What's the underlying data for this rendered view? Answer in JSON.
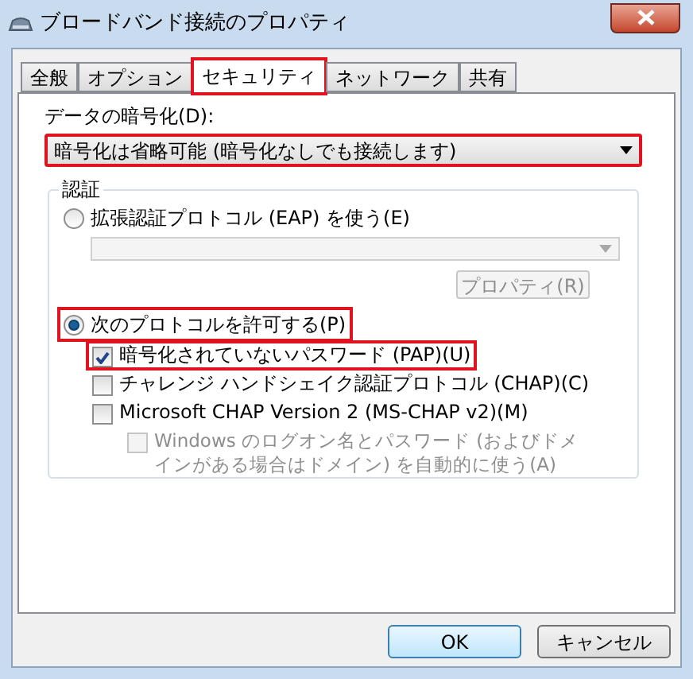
{
  "window": {
    "title": "ブロードバンド接続のプロパティ"
  },
  "tabs": [
    {
      "label": "全般",
      "selected": false,
      "highlighted": false
    },
    {
      "label": "オプション",
      "selected": false,
      "highlighted": false
    },
    {
      "label": "セキュリティ",
      "selected": true,
      "highlighted": true
    },
    {
      "label": "ネットワーク",
      "selected": false,
      "highlighted": false
    },
    {
      "label": "共有",
      "selected": false,
      "highlighted": false
    }
  ],
  "encryption": {
    "label": "データの暗号化(D):",
    "value": "暗号化は省略可能 (暗号化なしでも接続します)",
    "highlighted": true
  },
  "authentication": {
    "title": "認証",
    "eap": {
      "label": "拡張認証プロトコル (EAP) を使う(E)",
      "selected": false,
      "highlighted": false
    },
    "eap_properties_button": {
      "label": "プロパティ(R)",
      "disabled": true
    },
    "allow_protocols": {
      "label": "次のプロトコルを許可する(P)",
      "selected": true,
      "highlighted": true
    },
    "protocols": [
      {
        "label": "暗号化されていないパスワード (PAP)(U)",
        "checked": true,
        "disabled": false,
        "highlighted": true
      },
      {
        "label": "チャレンジ ハンドシェイク認証プロトコル (CHAP)(C)",
        "checked": false,
        "disabled": false,
        "highlighted": false
      },
      {
        "label": "Microsoft CHAP Version 2 (MS-CHAP v2)(M)",
        "checked": false,
        "disabled": false,
        "highlighted": false,
        "children": [
          {
            "label": "Windows のログオン名とパスワード (およびドメインがある場合はドメイン) を自動的に使う(A)",
            "checked": false,
            "disabled": true,
            "highlighted": false
          }
        ]
      }
    ]
  },
  "buttons": [
    {
      "label": "OK",
      "kind": "default"
    },
    {
      "label": "キャンセル",
      "kind": "normal"
    }
  ]
}
